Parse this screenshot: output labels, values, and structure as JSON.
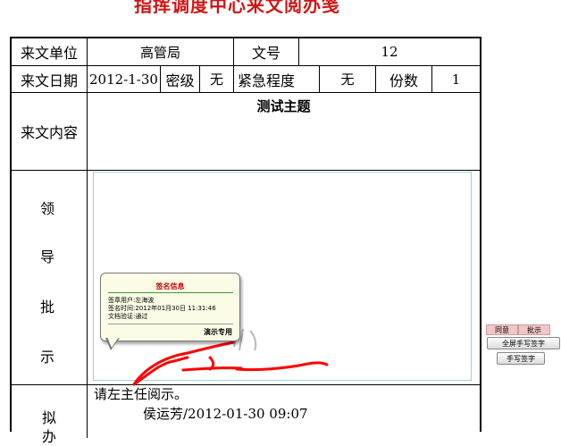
{
  "title": "指挥调度中心来文阅办笺",
  "form": {
    "row1": {
      "label_unit": "来文单位",
      "unit_value": "高管局",
      "label_num": "文号",
      "num_value": "12"
    },
    "row2": {
      "label_date": "来文日期",
      "date_value": "2012-1-30",
      "label_secret": "密级",
      "secret_value": "无",
      "label_urgency": "紧急程度",
      "urgency_value": "无",
      "label_copies": "份数",
      "copies_value": "1"
    },
    "row3": {
      "label_content": "来文内容",
      "content_value": "测试主题"
    },
    "row4": {
      "label_chars": [
        "领",
        "导",
        "批",
        "示"
      ]
    },
    "row5": {
      "label_chars": [
        "拟",
        "办"
      ],
      "opinion": "请左主任阅示。",
      "signer": "侯运芳/2012-01-30 09:07"
    }
  },
  "signature_tooltip": {
    "title": "签名信息",
    "user": "签章用户:左海波",
    "time": "签名时间:2012年01月30日  11:31:46",
    "verify": "文档验证:通过",
    "footer": "演示专用"
  },
  "side_buttons": {
    "agree": "同意",
    "instruct": "批示",
    "fullscreen_sign": "全屏手写签字",
    "hand_sign": "手写签字"
  },
  "colors": {
    "title": "#d21414",
    "ink": "#ff0000",
    "tooltip_bg": "#fbfbe6",
    "pink_button": "#f2c6c6"
  }
}
